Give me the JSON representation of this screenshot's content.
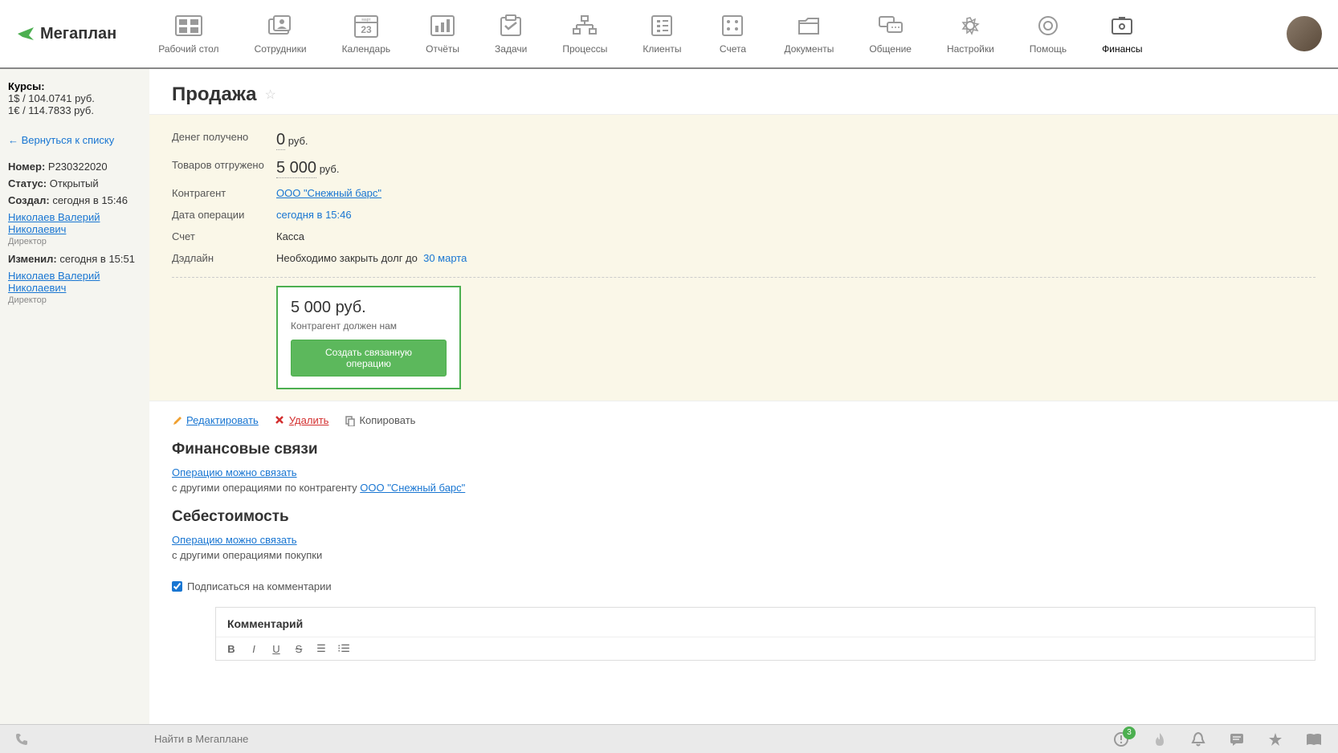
{
  "app": {
    "name": "Мегаплан"
  },
  "nav": {
    "items": [
      {
        "label": "Рабочий стол"
      },
      {
        "label": "Сотрудники"
      },
      {
        "label": "Календарь",
        "badge": "23"
      },
      {
        "label": "Отчёты"
      },
      {
        "label": "Задачи"
      },
      {
        "label": "Процессы"
      },
      {
        "label": "Клиенты"
      },
      {
        "label": "Счета"
      },
      {
        "label": "Документы"
      },
      {
        "label": "Общение"
      },
      {
        "label": "Настройки"
      },
      {
        "label": "Помощь"
      },
      {
        "label": "Финансы"
      }
    ]
  },
  "sidebar": {
    "rates_title": "Курсы:",
    "rate_usd": "1$ / 104.0741 руб.",
    "rate_eur": "1€ / 114.7833 руб.",
    "back_label": "Вернуться к списку",
    "number_label": "Номер:",
    "number_value": "Р230322020",
    "status_label": "Статус:",
    "status_value": "Открытый",
    "created_label": "Создал:",
    "created_value": "сегодня в 15:46",
    "creator_name": "Николаев Валерий Николаевич",
    "creator_role": "Директор",
    "modified_label": "Изменил:",
    "modified_value": "сегодня в 15:51",
    "modifier_name": "Николаев Валерий Николаевич",
    "modifier_role": "Директор"
  },
  "page": {
    "title": "Продажа",
    "details": {
      "money_received_label": "Денег получено",
      "money_received_value": "0",
      "money_received_unit": "руб.",
      "goods_shipped_label": "Товаров отгружено",
      "goods_shipped_value": "5 000",
      "goods_shipped_unit": "руб.",
      "counterparty_label": "Контрагент",
      "counterparty_value": "ООО \"Снежный барс\"",
      "operation_date_label": "Дата операции",
      "operation_date_value": "сегодня в 15:46",
      "account_label": "Счет",
      "account_value": "Касса",
      "deadline_label": "Дэдлайн",
      "deadline_text": "Необходимо закрыть долг до",
      "deadline_date": "30 марта"
    },
    "debt_box": {
      "amount": "5 000 руб.",
      "text": "Контрагент должен нам",
      "button": "Создать связанную операцию"
    },
    "actions": {
      "edit": "Редактировать",
      "delete": "Удалить",
      "copy": "Копировать"
    },
    "sections": {
      "finlinks_title": "Финансовые связи",
      "finlinks_link": "Операцию можно связать",
      "finlinks_text": "с другими операциями по контрагенту",
      "finlinks_counterparty": "ООО \"Снежный барс\"",
      "cost_title": "Себестоимость",
      "cost_link": "Операцию можно связать",
      "cost_text": "с другими операциями покупки"
    },
    "subscribe_label": "Подписаться на комментарии",
    "comment_title": "Комментарий"
  },
  "bottombar": {
    "search_placeholder": "Найти в Мегаплане",
    "alert_badge": "3"
  }
}
